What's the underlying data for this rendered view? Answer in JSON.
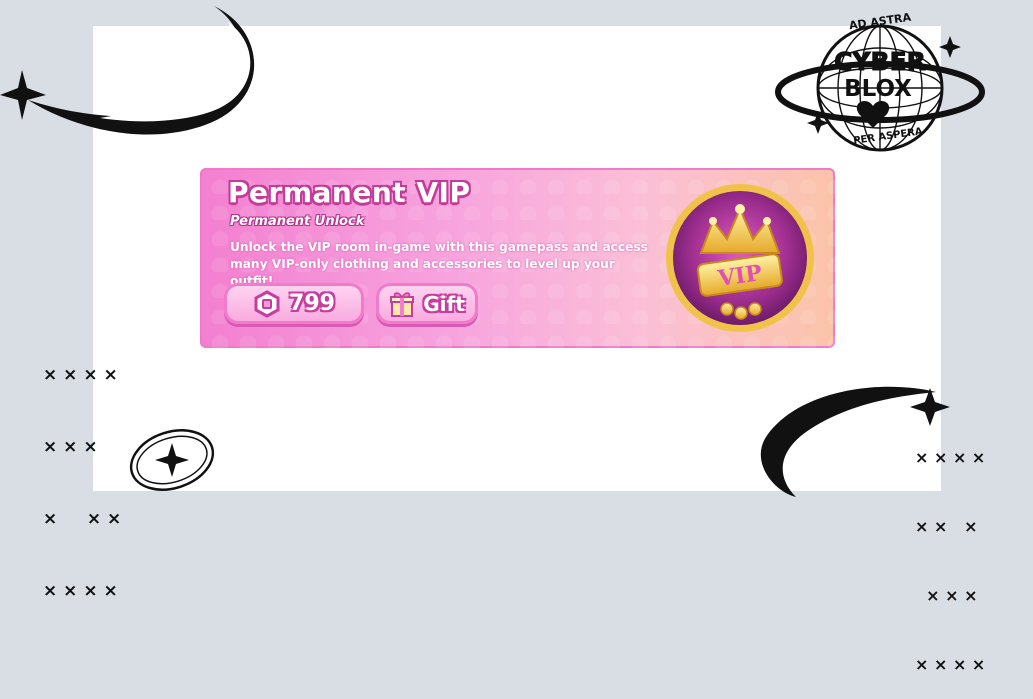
{
  "panel": {
    "title": "Permanent VIP",
    "subtitle": "Permanent Unlock",
    "description": "Unlock the VIP room in-game with this gamepass and access many VIP-only clothing and accessories to level up your outfit!",
    "price_label": "799",
    "gift_label": "Gift",
    "badge_text": "VIP"
  },
  "logo": {
    "top_text": "AD ASTRA",
    "line1": "CYBER",
    "line2": "BLOX",
    "bottom_text": "PER ASPERA"
  },
  "decor": {
    "x_pattern_left": [
      "× × × ×",
      "× × ×",
      "×     × ×",
      "× × × ×"
    ],
    "x_pattern_right": [
      "× × × ×",
      "× ×   ×",
      "  × × ×",
      "× × × ×"
    ]
  },
  "colors": {
    "panel_pink": "#f37fd0",
    "panel_peach": "#fbc4a8",
    "button_outline": "#f27acb",
    "text_outline": "#c23b98",
    "badge_gold": "#f1c24a",
    "badge_purple": "#9b2c8c",
    "background": "#d9dde4"
  },
  "icons": [
    "robux-icon",
    "gift-icon",
    "vip-crown-badge-icon",
    "sparkle-icon",
    "swoosh-icon",
    "globe-heart-icon"
  ]
}
